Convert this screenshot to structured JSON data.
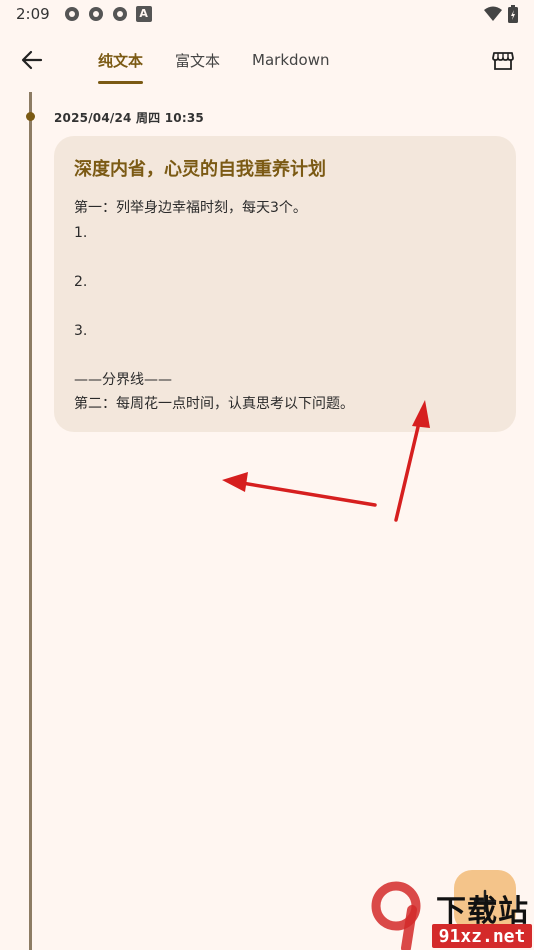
{
  "status_bar": {
    "time": "2:09",
    "notif_letter": "A"
  },
  "tabs": [
    {
      "label": "纯文本",
      "active": true
    },
    {
      "label": "富文本",
      "active": false
    },
    {
      "label": "Markdown",
      "active": false
    }
  ],
  "entry": {
    "date": "2025/04/24 周四 10:35",
    "title": "深度内省，心灵的自我重养计划",
    "lines": [
      "第一：列举身边幸福时刻，每天3个。",
      "1.",
      "",
      "2.",
      "",
      "3.",
      "",
      "——分界线——",
      "第二：每周花一点时间，认真思考以下问题。"
    ]
  },
  "watermark": {
    "text_cn": "下载站",
    "text_url": "91xz.net"
  },
  "colors": {
    "accent": "#7b5a14",
    "background": "#fff6f1",
    "card": "#f3e7dc",
    "arrow": "#d61f1f",
    "fab": "#f4c48a"
  }
}
